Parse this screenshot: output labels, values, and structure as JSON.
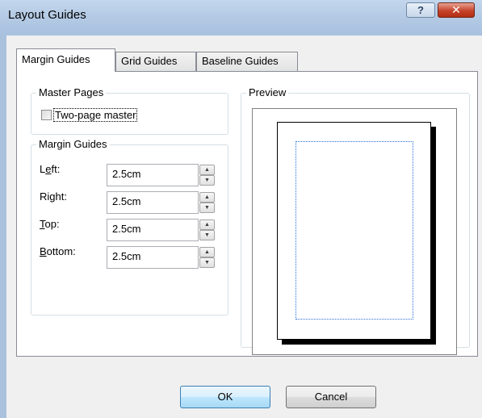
{
  "window": {
    "title": "Layout Guides",
    "help_glyph": "?",
    "close_glyph": "✕"
  },
  "tabs": [
    {
      "label": "Margin Guides",
      "active": true
    },
    {
      "label": "Grid Guides",
      "active": false
    },
    {
      "label": "Baseline Guides",
      "active": false
    }
  ],
  "master_pages": {
    "group_label": "Master Pages",
    "two_page_master_label": "Two-page master",
    "two_page_master_checked": false
  },
  "margin_guides": {
    "group_label": "Margin Guides",
    "fields": [
      {
        "label_pre": "L",
        "label_access": "e",
        "label_post": "ft:",
        "value": "2.5cm"
      },
      {
        "label_pre": "Ri",
        "label_access": "g",
        "label_post": "ht:",
        "value": "2.5cm"
      },
      {
        "label_pre": "",
        "label_access": "T",
        "label_post": "op:",
        "value": "2.5cm"
      },
      {
        "label_pre": "",
        "label_access": "B",
        "label_post": "ottom:",
        "value": "2.5cm"
      }
    ]
  },
  "preview": {
    "group_label": "Preview"
  },
  "buttons": {
    "ok_label": "OK",
    "cancel_label": "Cancel"
  },
  "colors": {
    "title_bar": "#b5cbe5",
    "close_button": "#c5432b",
    "margin_guide": "#2c6fd9",
    "dialog_background": "#f0f0f0"
  }
}
